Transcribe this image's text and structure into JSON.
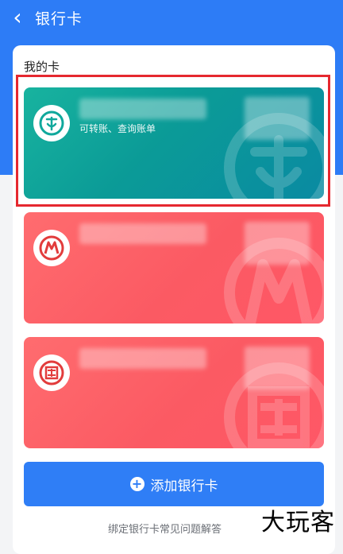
{
  "header": {
    "back_glyph": "‹",
    "title": "银行卡"
  },
  "section": {
    "title": "我的卡"
  },
  "cards": [
    {
      "subtitle": "可转账、查询账单",
      "icon": "agricultural-bank-icon",
      "color": "#0f9f9a"
    },
    {
      "subtitle": "",
      "icon": "china-merchants-bank-icon",
      "color": "#fb5a63"
    },
    {
      "subtitle": "",
      "icon": "icbc-bank-icon",
      "color": "#fb5a63"
    }
  ],
  "actions": {
    "add_card_label": "添加银行卡",
    "faq_label": "绑定银行卡常见问题解答"
  },
  "brand": {
    "watermark_text": "大玩客"
  },
  "colors": {
    "primary_blue": "#2d7cf6",
    "highlight_red": "#e5282f"
  }
}
